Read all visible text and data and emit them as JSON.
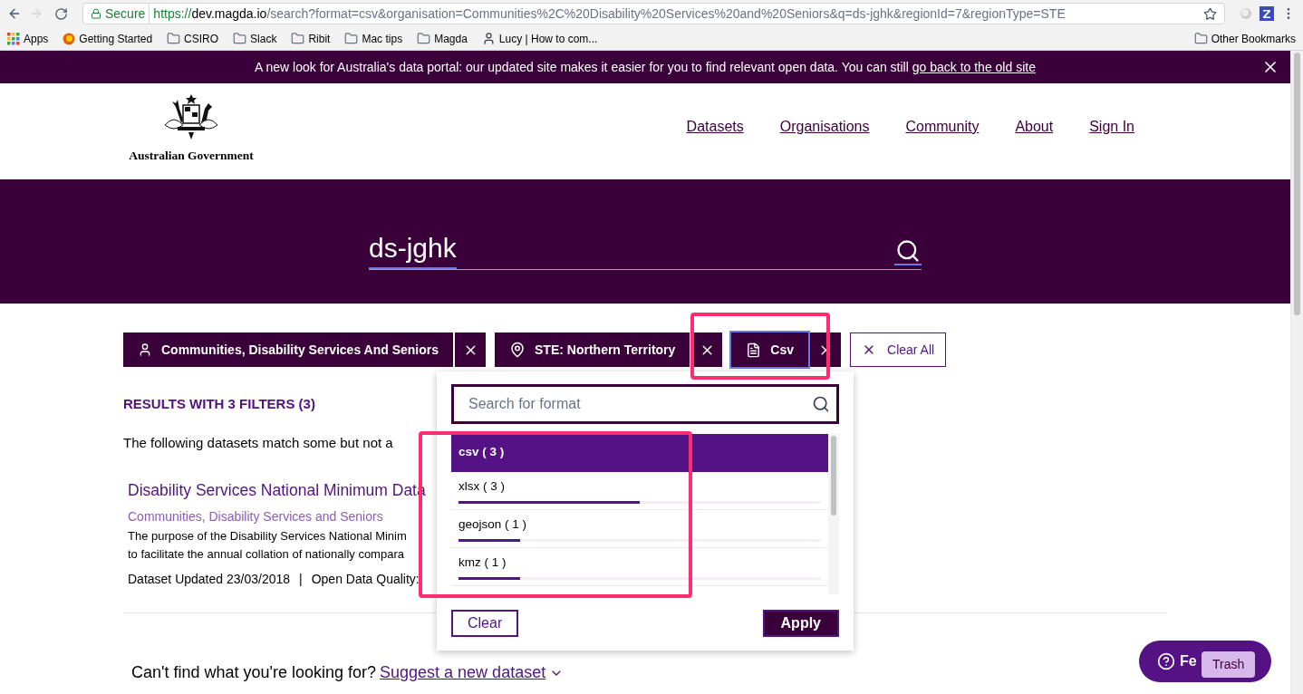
{
  "browser": {
    "secure_label": "Secure",
    "url": {
      "scheme": "https://",
      "host": "dev.magda.io",
      "path": "/search?format=csv&organisation=Communities%2C%20Disability%20Services%20and%20Seniors&q=ds-jghk&regionId=7&regionType=STE"
    },
    "bookmarks": [
      {
        "kind": "apps",
        "label": "Apps"
      },
      {
        "kind": "site",
        "label": "Getting Started"
      },
      {
        "kind": "folder",
        "label": "CSIRO"
      },
      {
        "kind": "folder",
        "label": "Slack"
      },
      {
        "kind": "folder",
        "label": "Ribit"
      },
      {
        "kind": "folder",
        "label": "Mac tips"
      },
      {
        "kind": "folder",
        "label": "Magda"
      },
      {
        "kind": "person",
        "label": "Lucy | How to com..."
      }
    ],
    "other_bookmarks": "Other Bookmarks"
  },
  "banner": {
    "text": "A new look for Australia's data portal: our updated site makes it easier for you to find relevant open data. You can still ",
    "link": "go back to the old site"
  },
  "header": {
    "logo_text": "Australian Government",
    "nav": [
      "Datasets",
      "Organisations",
      "Community",
      "About",
      "Sign In"
    ]
  },
  "search": {
    "value": "ds-jghk"
  },
  "filters": [
    {
      "kind": "publisher",
      "label": "Communities, Disability Services And Seniors",
      "focused": false
    },
    {
      "kind": "region",
      "label": "STE: Northern Territory",
      "focused": false
    },
    {
      "kind": "format",
      "label": "Csv",
      "focused": true
    }
  ],
  "clear_all": "Clear All",
  "results": {
    "heading": "RESULTS WITH 3 FILTERS (3)",
    "note": "The following datasets match some but not a",
    "dataset": {
      "title": "Disability Services National Minimum Data",
      "publisher": "Communities, Disability Services and Seniors",
      "description": [
        "The purpose of the Disability Services National Minim",
        "to facilitate the annual collation of nationally compara"
      ],
      "updated": "Dataset Updated 23/03/2018",
      "separator": "|",
      "quality": "Open Data Quality:"
    }
  },
  "format_dropdown": {
    "placeholder": "Search for format",
    "options": [
      {
        "label": "csv ( 3 )",
        "selected": true
      },
      {
        "label": "xlsx ( 3 )",
        "selected": false,
        "level": 0.5
      },
      {
        "label": "geojson ( 1 )",
        "selected": false,
        "level": 0.17
      },
      {
        "label": "kmz ( 1 )",
        "selected": false,
        "level": 0.17
      }
    ],
    "clear": "Clear",
    "apply": "Apply"
  },
  "footer": {
    "question": "Can't find what you're looking for?",
    "link": "Suggest a new dataset"
  },
  "feedback": {
    "label": "Fe"
  },
  "tooltip": "Trash"
}
